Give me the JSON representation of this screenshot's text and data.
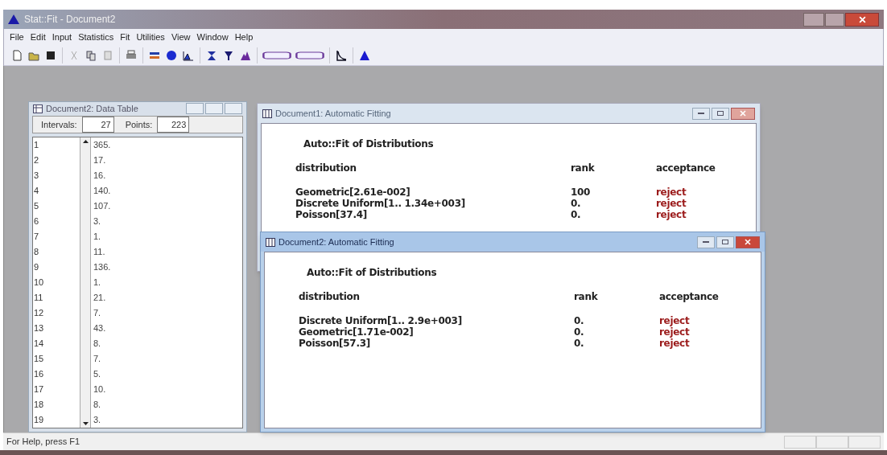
{
  "window": {
    "title": "Stat::Fit - Document2"
  },
  "menu": [
    "File",
    "Edit",
    "Input",
    "Statistics",
    "Fit",
    "Utilities",
    "View",
    "Window",
    "Help"
  ],
  "data_table": {
    "title": "Document2: Data Table",
    "intervals_label": "Intervals:",
    "intervals": "27",
    "points_label": "Points:",
    "points": "223",
    "rows": [
      {
        "index": "1",
        "value": "365."
      },
      {
        "index": "2",
        "value": "17."
      },
      {
        "index": "3",
        "value": "16."
      },
      {
        "index": "4",
        "value": "140."
      },
      {
        "index": "5",
        "value": "107."
      },
      {
        "index": "6",
        "value": "3."
      },
      {
        "index": "7",
        "value": "1."
      },
      {
        "index": "8",
        "value": "11."
      },
      {
        "index": "9",
        "value": "136."
      },
      {
        "index": "10",
        "value": "1."
      },
      {
        "index": "11",
        "value": "21."
      },
      {
        "index": "12",
        "value": "7."
      },
      {
        "index": "13",
        "value": "43."
      },
      {
        "index": "14",
        "value": "8."
      },
      {
        "index": "15",
        "value": "7."
      },
      {
        "index": "16",
        "value": "5."
      },
      {
        "index": "17",
        "value": "10."
      },
      {
        "index": "18",
        "value": "8."
      },
      {
        "index": "19",
        "value": "3."
      }
    ]
  },
  "fit_windows": [
    {
      "title": "Document1: Automatic Fitting",
      "active": false,
      "heading": "Auto::Fit of Distributions",
      "columns": [
        "distribution",
        "rank",
        "acceptance"
      ],
      "rows": [
        {
          "distribution": "Geometric[2.61e-002]",
          "rank": "100",
          "acceptance": "reject"
        },
        {
          "distribution": "Discrete Uniform[1.. 1.34e+003]",
          "rank": "0.",
          "acceptance": "reject"
        },
        {
          "distribution": "Poisson[37.4]",
          "rank": "0.",
          "acceptance": "reject"
        }
      ]
    },
    {
      "title": "Document2: Automatic Fitting",
      "active": true,
      "heading": "Auto::Fit of Distributions",
      "columns": [
        "distribution",
        "rank",
        "acceptance"
      ],
      "rows": [
        {
          "distribution": "Discrete Uniform[1.. 2.9e+003]",
          "rank": "0.",
          "acceptance": "reject"
        },
        {
          "distribution": "Geometric[1.71e-002]",
          "rank": "0.",
          "acceptance": "reject"
        },
        {
          "distribution": "Poisson[57.3]",
          "rank": "0.",
          "acceptance": "reject"
        }
      ]
    }
  ],
  "status_bar": {
    "text": "For Help, press F1"
  }
}
